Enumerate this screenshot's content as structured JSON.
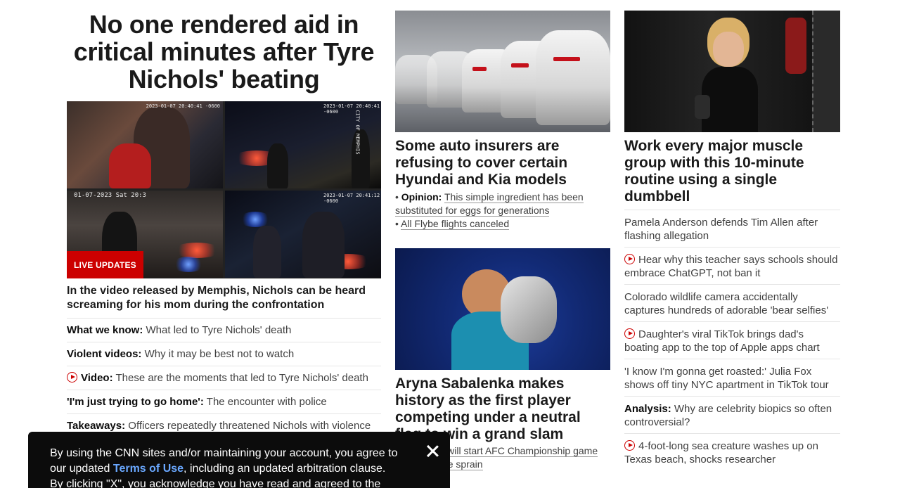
{
  "lead": {
    "title": "No one rendered aid in critical minutes after Tyre Nichols' beating",
    "badge": "LIVE UPDATES",
    "subhead": "In the video released by Memphis, Nichols can be heard screaming for his mom during the confrontation",
    "cam_stamp_1": "2023-01-07 20:40:41 -0600",
    "cam_stamp_2": "2023-01-07 20:41:12 -0600",
    "cam_date": "01-07-2023 Sat 20:3",
    "watermark": "CITY OF MEMPHIS",
    "links": [
      {
        "prefix": "What we know:",
        "text": "What led to Tyre Nichols' death",
        "video": false
      },
      {
        "prefix": "Violent videos:",
        "text": "Why it may be best not to watch",
        "video": false
      },
      {
        "prefix": "Video:",
        "text": "These are the moments that led to Tyre Nichols' death",
        "video": true
      },
      {
        "prefix": "'I'm just trying to go home':",
        "text": "The encounter with police",
        "video": false
      },
      {
        "prefix": "Takeaways:",
        "text": "Officers repeatedly threatened Nichols with violence",
        "video": false
      }
    ]
  },
  "middle": {
    "card1": {
      "title": "Some auto insurers are refusing to cover certain Hyundai and Kia models",
      "bullets": [
        {
          "prefix": "Opinion:",
          "text": "This simple ingredient has been substituted for eggs for generations"
        },
        {
          "prefix": "",
          "text": "All Flybe flights canceled"
        }
      ]
    },
    "card2": {
      "title": "Aryna Sabalenka makes history as the first player competing under a neutral flag to win a grand slam",
      "bullet_text": "Mahomes will start AFC Championship game despite ankle sprain"
    }
  },
  "right": {
    "card_title": "Work every major muscle group with this 10-minute routine using a single dumbbell",
    "items": [
      {
        "prefix": "",
        "text": "Pamela Anderson defends Tim Allen after flashing allegation",
        "video": false
      },
      {
        "prefix": "",
        "text": "Hear why this teacher says schools should embrace ChatGPT, not ban it",
        "video": true
      },
      {
        "prefix": "",
        "text": "Colorado wildlife camera accidentally captures hundreds of adorable 'bear selfies'",
        "video": false
      },
      {
        "prefix": "",
        "text": "Daughter's viral TikTok brings dad's boating app to the top of Apple apps chart",
        "video": true
      },
      {
        "prefix": "",
        "text": "'I know I'm gonna get roasted:' Julia Fox shows off tiny NYC apartment in TikTok tour",
        "video": false
      },
      {
        "prefix": "Analysis:",
        "text": "Why are celebrity biopics so often controversial?",
        "video": false
      },
      {
        "prefix": "",
        "text": "4-foot-long sea creature washes up on Texas beach, shocks researcher",
        "video": true
      }
    ]
  },
  "consent": {
    "text_before": "By using the CNN sites and/or maintaining your account, you agree to our updated",
    "link": "Terms of Use",
    "text_after": ", including an updated arbitration clause.",
    "line3": "By clicking \"X\", you acknowledge you have read and agreed to the"
  },
  "colors": {
    "accent": "#cc0000",
    "link_blue": "#6aa8ff",
    "consent_bg": "#0c0c0c"
  }
}
